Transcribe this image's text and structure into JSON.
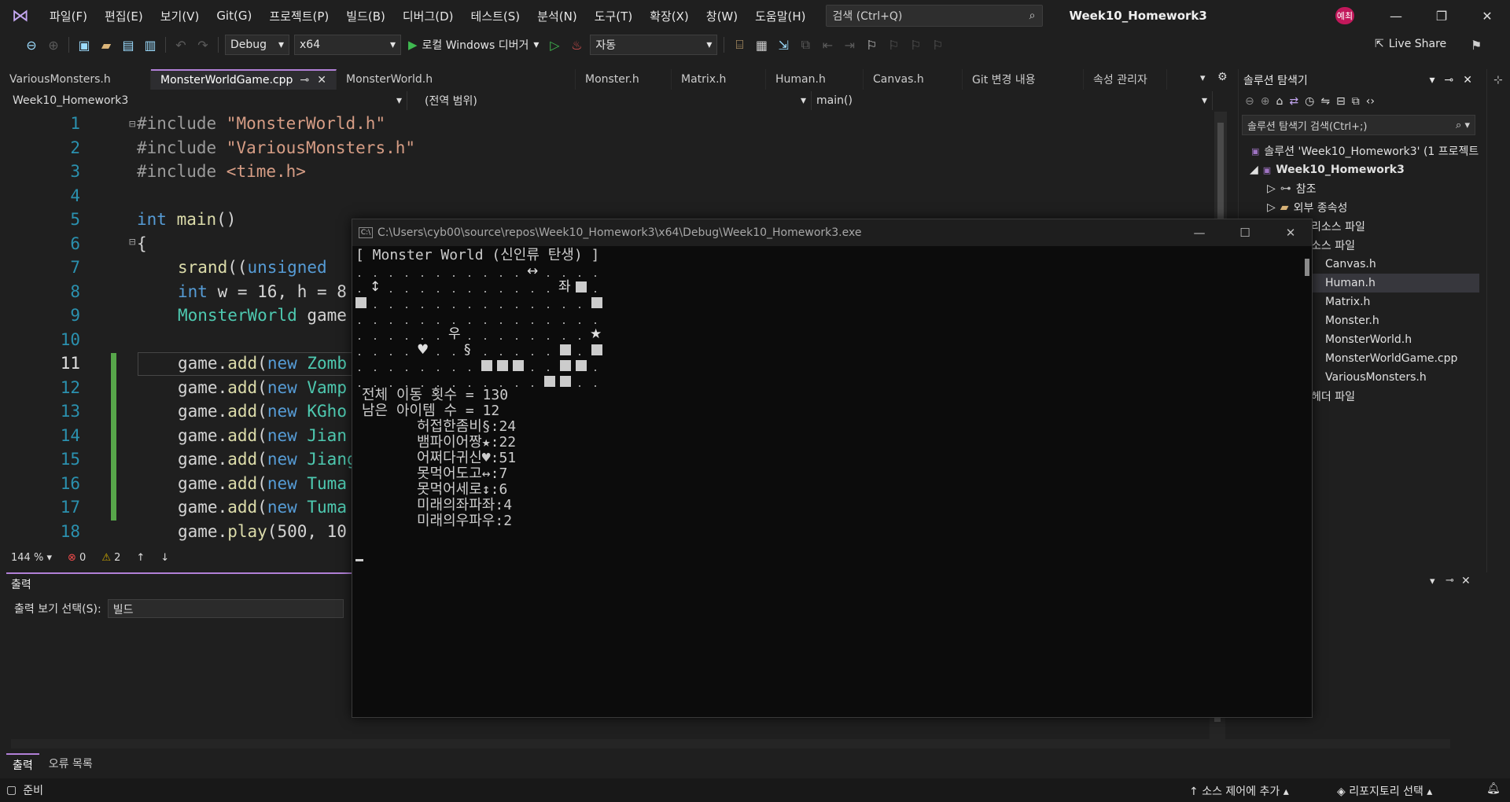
{
  "menubar": {
    "items": [
      "파일(F)",
      "편집(E)",
      "보기(V)",
      "Git(G)",
      "프로젝트(P)",
      "빌드(B)",
      "디버그(D)",
      "테스트(S)",
      "분석(N)",
      "도구(T)",
      "확장(X)",
      "창(W)",
      "도움말(H)"
    ],
    "search_placeholder": "검색 (Ctrl+Q)",
    "window_title": "Week10_Homework3",
    "user_badge": "예최"
  },
  "toolbar": {
    "config": "Debug",
    "platform": "x64",
    "run_label": "로컬 Windows 디버거",
    "auto": "자동",
    "live_share": "Live Share"
  },
  "tabs": [
    {
      "label": "VariousMonsters.h",
      "active": false
    },
    {
      "label": "MonsterWorldGame.cpp",
      "active": true
    },
    {
      "label": "MonsterWorld.h",
      "active": false
    },
    {
      "label": "Monster.h",
      "active": false
    },
    {
      "label": "Matrix.h",
      "active": false
    },
    {
      "label": "Human.h",
      "active": false
    },
    {
      "label": "Canvas.h",
      "active": false
    },
    {
      "label": "Git 변경 내용",
      "active": false
    },
    {
      "label": "속성 관리자",
      "active": false
    }
  ],
  "navbar": {
    "project": "Week10_Homework3",
    "scope": "(전역 범위)",
    "member": "main()"
  },
  "code": {
    "line_numbers": [
      "1",
      "2",
      "3",
      "4",
      "5",
      "6",
      "7",
      "8",
      "9",
      "10",
      "11",
      "12",
      "13",
      "14",
      "15",
      "16",
      "17",
      "18"
    ],
    "l1_a": "#include ",
    "l1_b": "\"MonsterWorld.h\"",
    "l2_a": "#include ",
    "l2_b": "\"VariousMonsters.h\"",
    "l3_a": "#include ",
    "l3_b": "<time.h>",
    "l5_a": "int",
    "l5_b": " main",
    "l5_c": "()",
    "l6": "{",
    "l7_a": "srand",
    "l7_b": "((",
    "l7_c": "unsigned",
    "l8_a": "int",
    "l8_b": " w = 16, h = 8",
    "l9_a": "MonsterWorld",
    "l9_b": " game",
    "add_prefix": "game.",
    "add_fn": "add",
    "add_paren": "(",
    "add_new": "new",
    "l11_t": " Zomb",
    "l12_t": " Vamp",
    "l13_t": " KGho",
    "l14_t": " Jian",
    "l15_t": " Jiang",
    "l16_t": " Tuma",
    "l17_t": " Tuma",
    "l18_a": "game.",
    "l18_b": "play",
    "l18_c": "(500, 10"
  },
  "editor_status": {
    "zoom": "144 %",
    "errors": "0",
    "warnings": "2"
  },
  "output": {
    "title": "출력",
    "select_label": "출력 보기 선택(S):",
    "select_value": "빌드"
  },
  "bottom_tabs": [
    "출력",
    "오류 목록"
  ],
  "statusbar": {
    "ready": "준비",
    "source_control": "소스 제어에 추가",
    "repo": "리포지토리 선택"
  },
  "solution_explorer": {
    "title": "솔루션 탐색기",
    "search": "솔루션 탐색기 검색(Ctrl+;)",
    "solution": "솔루션 'Week10_Homework3' (1 프로젝트",
    "project": "Week10_Homework3",
    "refs": "참조",
    "external": "외부 종속성",
    "resource": "리소스 파일",
    "source": "소스 파일",
    "files": [
      "Canvas.h",
      "Human.h",
      "Matrix.h",
      "Monster.h",
      "MonsterWorld.h",
      "MonsterWorldGame.cpp",
      "VariousMonsters.h"
    ],
    "header": "헤더 파일",
    "selected": "Human.h"
  },
  "console": {
    "title": "C:\\Users\\cyb00\\source\\repos\\Week10_Homework3\\x64\\Debug\\Week10_Homework3.exe",
    "header": "[ Monster World (신인류 탄생) ]",
    "grid_symbols": {
      "arrow_lr": "↔",
      "arrow_ud": "↕",
      "jwa": "좌",
      "u": "우",
      "star": "★",
      "heart": "♥",
      "section": "§"
    },
    "total_moves": "전체 이동 횟수 = 130",
    "items_left": "남은 아이템 수 = 12",
    "monsters": [
      "허접한좀비§:24",
      "뱀파이어짱★:22",
      "어쩌다귀신♥:51",
      "못먹어도고↔:7",
      "못먹어세로↕:6",
      "미래의좌파좌:4",
      "미래의우파우:2"
    ]
  }
}
